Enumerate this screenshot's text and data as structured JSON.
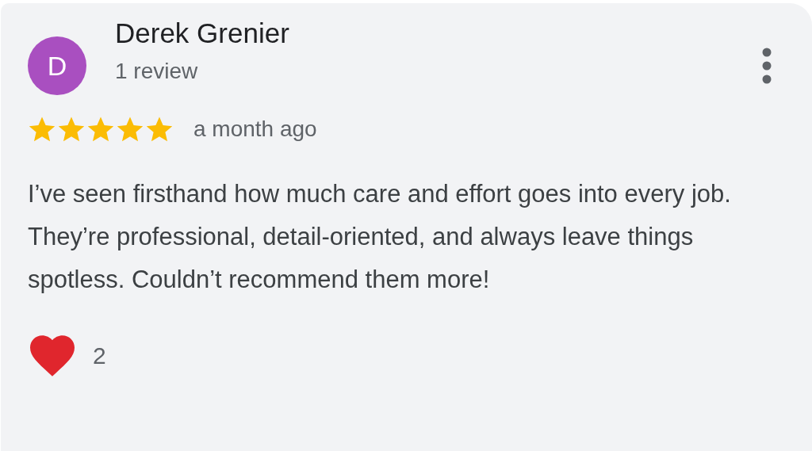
{
  "review": {
    "avatar_letter": "D",
    "author": "Derek Grenier",
    "author_meta": "1 review",
    "stars": 5,
    "time": "a month ago",
    "text": "I’ve seen firsthand how much care and effort goes into every job. They’re professional, detail-oriented, and always leave things spotless. Couldn’t recommend them more!",
    "reaction_count": "2"
  }
}
